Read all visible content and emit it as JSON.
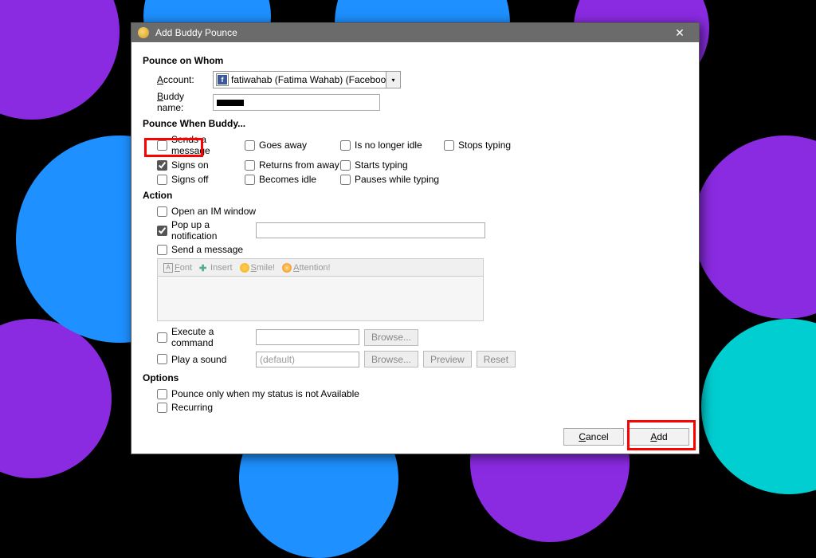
{
  "window": {
    "title": "Add Buddy Pounce"
  },
  "sections": {
    "pounce_whom": "Pounce on Whom",
    "pounce_when": "Pounce When Buddy...",
    "action": "Action",
    "options": "Options"
  },
  "labels": {
    "account": "Account:",
    "account_u": "A",
    "buddy_name": "Buddy name:",
    "buddy_u": "B"
  },
  "account": {
    "text": "fatiwahab (Fatima Wahab) (Facebook)"
  },
  "triggers": {
    "sends_msg": "Sends a message",
    "signs_on": "Signs on",
    "signs_off": "Signs off",
    "goes_away": "Goes away",
    "returns_away": "Returns from away",
    "becomes_idle": "Becomes idle",
    "no_longer_idle": "Is no longer idle",
    "starts_typing": "Starts typing",
    "pauses_typing": "Pauses while typing",
    "stops_typing": "Stops typing"
  },
  "actions": {
    "open_im": "Open an IM window",
    "popup": "Pop up a notification",
    "send_msg": "Send a message",
    "exec_cmd": "Execute a command",
    "play_sound": "Play a sound",
    "sound_default": "(default)"
  },
  "toolbar": {
    "font": "Font",
    "insert": "Insert",
    "smile": "Smile!",
    "attention": "Attention!"
  },
  "file_btns": {
    "browse": "Browse...",
    "preview": "Preview",
    "reset": "Reset"
  },
  "options": {
    "pounce_only": "Pounce only when my status is not Available",
    "recurring": "Recurring"
  },
  "buttons": {
    "cancel": "Cancel",
    "add": "Add"
  }
}
